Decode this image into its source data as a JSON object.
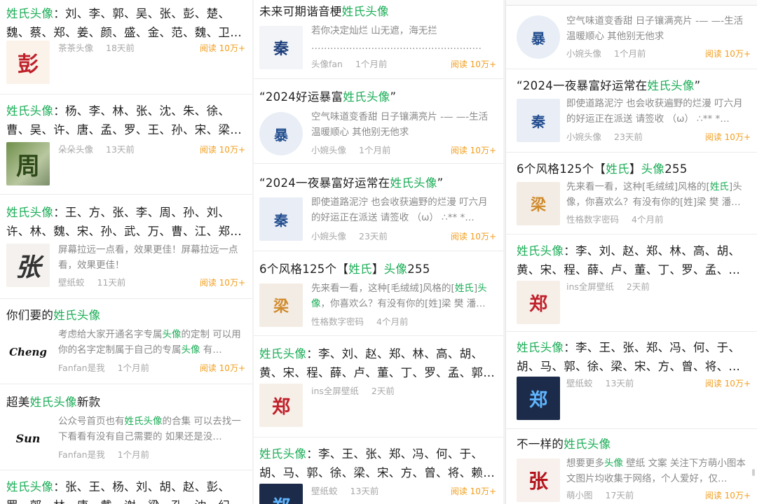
{
  "colors": {
    "highlight": "#1aad56",
    "reads": "#f29d1b",
    "meta": "#a8a8a8"
  },
  "col1": [
    {
      "title_hl": "姓氏头像",
      "title_rest": "：刘、李、郭、吴、张、彭、楚、魏、蔡、郑、姜、颜、盛、金、范、魏、卫…",
      "desc": "",
      "author": "茶茶头像",
      "time": "18天前",
      "reads": "阅读 10万+",
      "icon": "peng-doll-icon",
      "glyph": "彭"
    },
    {
      "title_hl": "姓氏头像",
      "title_rest": "：杨、李、林、张、沈、朱、徐、曹、吴、许、唐、孟、罗、王、孙、宋、梁…",
      "desc": "",
      "author": "朵朵头像",
      "time": "13天前",
      "reads": "阅读 10万+",
      "icon": "zhou-green-icon",
      "glyph": "周"
    },
    {
      "title_hl": "姓氏头像",
      "title_rest": "：王、方、张、李、周、孙、刘、许、林、魏、宋、孙、武、万、曹、江、郑…",
      "desc": "屏幕拉远一点看，效果更佳！屏幕拉远一点看，效果更佳！",
      "author": "壁纸蛟",
      "time": "11天前",
      "reads": "阅读 10万+",
      "icon": "zhang-ink-icon",
      "glyph": "张"
    },
    {
      "title_pre": "你们要的",
      "title_hl": "姓氏头像",
      "title_rest": "",
      "desc_pre": "考虑给大家开通名字专属",
      "desc_hl": "头像",
      "desc_mid": "的定制 可以用你的名字定制属于自己的专属",
      "desc_hl2": "头像",
      "desc_post": " 有…",
      "author": "Fanfan是我",
      "time": "1个月前",
      "reads": "阅读 10万+",
      "icon": "cheng-signature-icon",
      "glyph": "Cheng"
    },
    {
      "title_pre": "超美",
      "title_hl": "姓氏头像",
      "title_rest": "新款",
      "desc_pre": "公众号首页也有",
      "desc_hl": "姓氏头像",
      "desc_mid": "的合集 可以去找一下看看有没有自己需要的 如果还是没…",
      "desc_hl2": "",
      "desc_post": "",
      "author": "Fanfan是我",
      "time": "1个月前",
      "reads": "",
      "icon": "sun-signature-icon",
      "glyph": "Sun"
    },
    {
      "title_hl": "姓氏头像",
      "title_rest": "：张、王、杨、刘、胡、赵、彭、罗、郭、林、唐、戴、谢、梁、孔、沈、纪…"
    }
  ],
  "col2": [
    {
      "title_pre": "未来可期谐音梗",
      "title_hl": "姓氏头像",
      "title_rest": "",
      "desc": "若你决定灿烂 山无遮，海无拦 ………………………………………………",
      "author": "头像fan",
      "time": "1个月前",
      "reads": "阅读 10万+",
      "icon": "qin-plate-icon",
      "glyph": "秦"
    },
    {
      "title_pre": "“2024好运暴富",
      "title_hl": "姓氏头像",
      "title_rest": "”",
      "desc": "空气味道变香甜 日子镶满亮片 -— —-生活温暖顺心 其他别无他求",
      "author": "小婉头像",
      "time": "1个月前",
      "reads": "阅读 10万+",
      "icon": "round-avatar-icon",
      "glyph": "暴"
    },
    {
      "title_pre": "“2024一夜暴富好运常在",
      "title_hl": "姓氏头像",
      "title_rest": "”",
      "desc": "即使道路泥泞 也会收获遍野的烂漫 叮六月的好运正在派送 请签收 （ω） ∴** *…",
      "author": "小婉头像",
      "time": "23天前",
      "reads": "阅读 10万+",
      "icon": "qin-round-icon",
      "glyph": "秦"
    },
    {
      "title_pre": "6个风格125个【",
      "title_hl": "姓氏",
      "title_rest": "】",
      "title_hl2": "头像",
      "title_post": "255",
      "desc_pre": "先来看一看，这种[毛绒绒]风格的[",
      "desc_hl": "姓氏",
      "desc_mid": "]",
      "desc_hl2": "头像",
      "desc_post": "，你喜欢么？有没有你的[姓]梁 樊 潘…",
      "author": "性格数字密码",
      "time": "4个月前",
      "reads": "",
      "icon": "plush-style-icon",
      "glyph": "梁"
    },
    {
      "title_hl": "姓氏头像",
      "title_rest": "：李、刘、赵、郑、林、高、胡、黄、宋、程、薛、卢、董、丁、罗、孟、郭…",
      "desc": "",
      "author": "ins全屏壁纸",
      "time": "2天前",
      "reads": "",
      "icon": "zheng-bear-icon",
      "glyph": "郑"
    },
    {
      "title_hl": "姓氏头像",
      "title_rest": "：李、王、张、郑、冯、何、于、胡、马、郭、徐、梁、宋、方、曾、将、赖…",
      "desc": "",
      "author": "壁纸蛟",
      "time": "13天前",
      "reads": "阅读 10万+",
      "icon": "zheng-neon-icon",
      "glyph": "郑"
    }
  ],
  "col3": [
    {
      "desc": "空气味道变香甜 日子镶满亮片 -— —-生活温暖顺心 其他别无他求",
      "author": "小婉头像",
      "time": "1个月前",
      "reads": "阅读 10万+",
      "icon": "round-avatar-icon",
      "glyph": "暴"
    },
    {
      "title_pre": "“2024一夜暴富好运常在",
      "title_hl": "姓氏头像",
      "title_rest": "”",
      "desc": "即使道路泥泞 也会收获遍野的烂漫 叮六月的好运正在派送 请签收 （ω） ∴** *…",
      "author": "小婉头像",
      "time": "23天前",
      "reads": "阅读 10万+",
      "icon": "qin-round-icon",
      "glyph": "秦"
    },
    {
      "title_pre": "6个风格125个【",
      "title_hl": "姓氏",
      "title_rest": "】",
      "title_hl2": "头像",
      "title_post": "255",
      "desc_pre": "先来看一看，这种[毛绒绒]风格的[",
      "desc_hl": "姓氏",
      "desc_mid": "]头像",
      "desc_hl2": "头像",
      "desc_post": "，你喜欢么？有没有你的[姓]梁 樊 潘…",
      "author": "性格数字密码",
      "time": "4个月前",
      "reads": "",
      "icon": "plush-style-icon",
      "glyph": "梁"
    },
    {
      "title_hl": "姓氏头像",
      "title_rest": "：李、刘、赵、郑、林、高、胡、黄、宋、程、薛、卢、董、丁、罗、孟、郭…",
      "desc": "",
      "author": "ins全屏壁纸",
      "time": "2天前",
      "reads": "",
      "icon": "zheng-bear-icon",
      "glyph": "郑"
    },
    {
      "title_hl": "姓氏头像",
      "title_rest": "：李、王、张、郑、冯、何、于、胡、马、郭、徐、梁、宋、方、曾、将、赖…",
      "desc": "",
      "author": "壁纸蛟",
      "time": "13天前",
      "reads": "阅读 10万+",
      "icon": "zheng-neon-icon",
      "glyph": "郑"
    },
    {
      "title_pre": "不一样的",
      "title_hl": "姓氏头像",
      "title_rest": "",
      "desc_pre": "想要更多",
      "desc_hl": "头像",
      "desc_mid": " 壁纸 文案 关注下方萌小图本文图片均收集于网络，个人爱好，仅…",
      "desc_hl2": "",
      "desc_post": "",
      "author": "萌小图",
      "time": "17天前",
      "reads": "阅读 10万+",
      "icon": "zhang-red-icon",
      "glyph": "张"
    }
  ]
}
